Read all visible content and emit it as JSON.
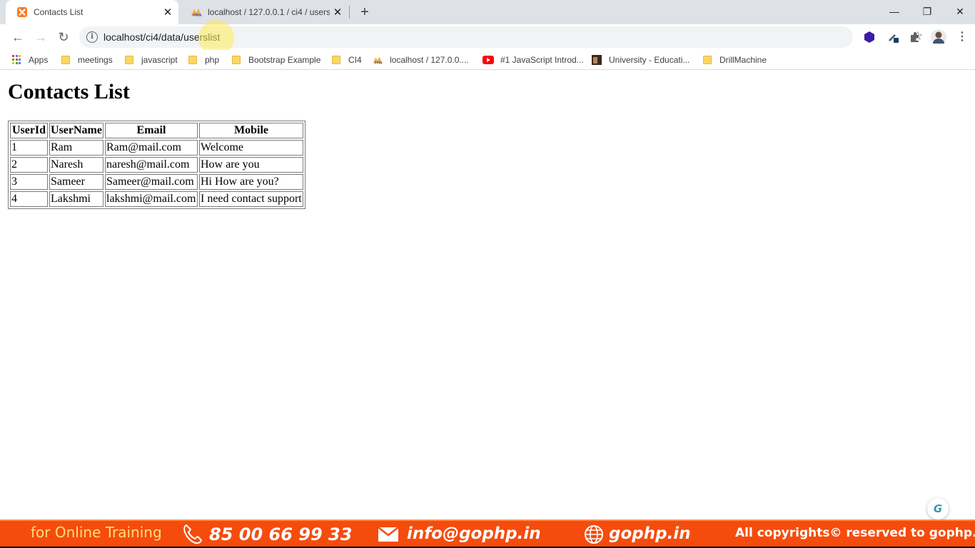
{
  "browser": {
    "tabs": [
      {
        "title": "Contacts List",
        "icon": "xampp-icon",
        "active": true
      },
      {
        "title": "localhost / 127.0.0.1 / ci4 / users",
        "icon": "phpmyadmin-icon",
        "active": false
      }
    ],
    "new_tab": "+",
    "window_controls": {
      "minimize": "—",
      "restore": "❐",
      "close": "✕"
    },
    "tab_close": "✕",
    "nav": {
      "back": "←",
      "forward": "→",
      "reload": "↻"
    },
    "address": {
      "info": "i",
      "url": "localhost/ci4/data/userslist"
    },
    "star": "☆",
    "bookmarks": [
      {
        "label": "Apps",
        "icon": "apps-grid-icon"
      },
      {
        "label": "meetings",
        "icon": "folder-icon"
      },
      {
        "label": "javascript",
        "icon": "folder-icon"
      },
      {
        "label": "php",
        "icon": "folder-icon"
      },
      {
        "label": "Bootstrap Example",
        "icon": "folder-icon"
      },
      {
        "label": "CI4",
        "icon": "folder-icon"
      },
      {
        "label": "localhost / 127.0.0....",
        "icon": "phpmyadmin-icon"
      },
      {
        "label": "#1 JavaScript Introd...",
        "icon": "youtube-icon"
      },
      {
        "label": "University - Educati...",
        "icon": "university-icon"
      },
      {
        "label": "DrillMachine",
        "icon": "folder-icon"
      }
    ]
  },
  "page": {
    "heading": "Contacts List",
    "table": {
      "headers": [
        "UserId",
        "UserName",
        "Email",
        "Mobile"
      ],
      "rows": [
        [
          "1",
          "Ram",
          "Ram@mail.com",
          "Welcome"
        ],
        [
          "2",
          "Naresh",
          "naresh@mail.com",
          "How are you"
        ],
        [
          "3",
          "Sameer",
          "Sameer@mail.com",
          "Hi How are you?"
        ],
        [
          "4",
          "Lakshmi",
          "lakshmi@mail.com",
          "I need contact support"
        ]
      ]
    },
    "badge": "G"
  },
  "banner": {
    "training": "for Online Training",
    "phone": "85 00 66 99 33",
    "email": "info@gophp.in",
    "website": "gophp.in",
    "copyright": "All copyrights© reserved to gophp.in"
  },
  "colors": {
    "tabstrip": "#dee1e6",
    "omnibox": "#f1f3f4",
    "folder": "#fcd663",
    "banner": "#f54c0d",
    "banner_training_text": "#ffe07a",
    "youtube": "#ff0000",
    "xampp": "#fb7a24"
  }
}
